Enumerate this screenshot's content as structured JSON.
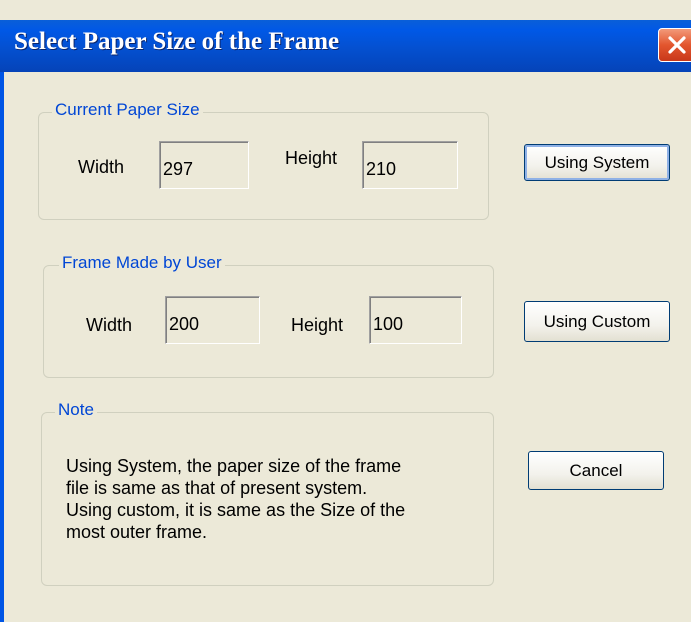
{
  "window": {
    "title": "Select Paper Size of the Frame"
  },
  "colors": {
    "titlebar": "#0058e6",
    "legend": "#0046d5",
    "dialog_bg": "#ece9d8",
    "close_button": "#e3562e"
  },
  "current_paper": {
    "legend": "Current Paper Size",
    "width_label": "Width",
    "width_value": "297",
    "height_label": "Height",
    "height_value": "210"
  },
  "user_frame": {
    "legend": "Frame Made by User",
    "width_label": "Width",
    "width_value": "200",
    "height_label": "Height",
    "height_value": "100"
  },
  "note": {
    "legend": "Note",
    "lines": [
      "Using System, the paper size of the frame",
      "file is same as that of present system.",
      "Using custom, it is same as the Size of the",
      "most outer frame."
    ]
  },
  "buttons": {
    "using_system": "Using System",
    "using_custom": "Using Custom",
    "cancel": "Cancel"
  },
  "icons": {
    "close": "close-icon"
  }
}
